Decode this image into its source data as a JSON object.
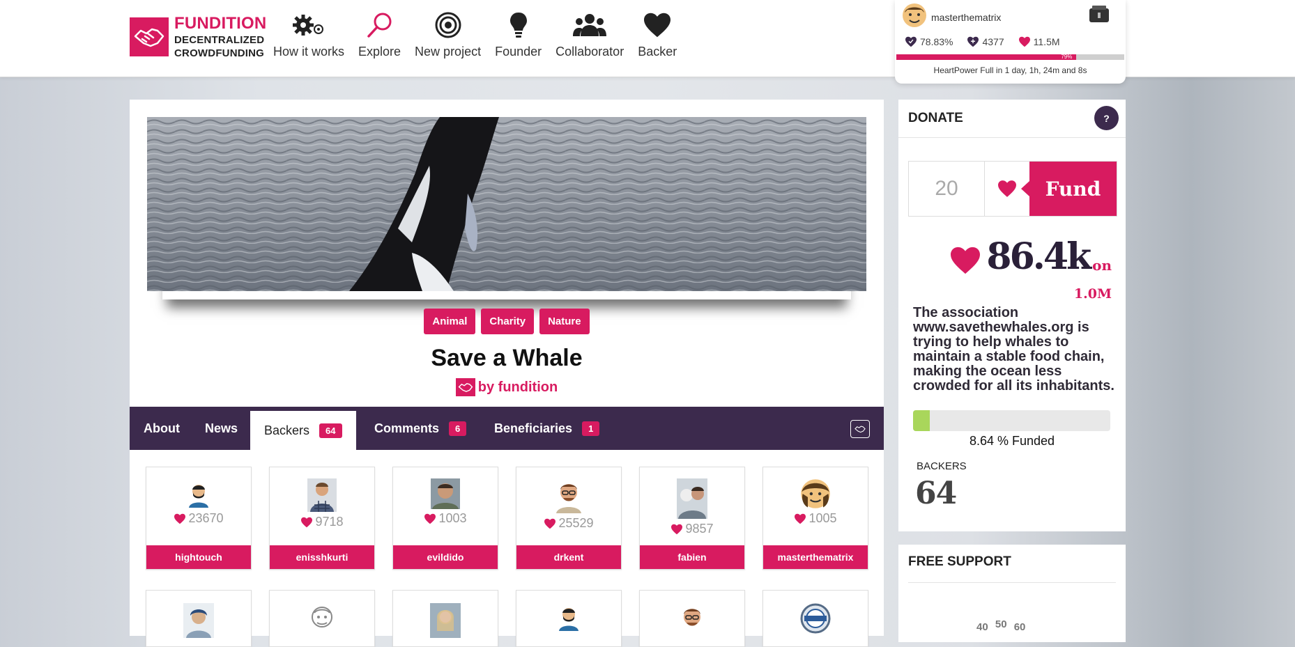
{
  "logo": {
    "line1": "FUNDITION",
    "line2": "DECENTRALIZED",
    "line3": "CROWDFUNDING"
  },
  "nav": [
    {
      "label": "How it works",
      "icon": "gears-icon"
    },
    {
      "label": "Explore",
      "icon": "search-icon"
    },
    {
      "label": "New project",
      "icon": "target-icon"
    },
    {
      "label": "Founder",
      "icon": "lightbulb-icon"
    },
    {
      "label": "Collaborator",
      "icon": "group-icon"
    },
    {
      "label": "Backer",
      "icon": "heart-icon"
    }
  ],
  "user": {
    "name": "masterthematrix",
    "stats": [
      {
        "value": "78.83%",
        "icon": "heart-outline-icon"
      },
      {
        "value": "4377",
        "icon": "heart-outline-icon"
      },
      {
        "value": "11.5M",
        "icon": "heart-icon"
      }
    ],
    "heartpower_percent": 79,
    "heartpower_label": "79%",
    "note": "HeartPower Full in 1 day, 1h, 24m and 8s"
  },
  "project": {
    "tags": [
      "Animal",
      "Charity",
      "Nature"
    ],
    "title": "Save a Whale",
    "byline": "by fundition"
  },
  "tabs": [
    {
      "label": "About",
      "count": null
    },
    {
      "label": "News",
      "count": null
    },
    {
      "label": "Backers",
      "count": "64"
    },
    {
      "label": "Comments",
      "count": "6"
    },
    {
      "label": "Beneficiaries",
      "count": "1"
    }
  ],
  "backers": [
    {
      "name": "hightouch",
      "hp": "23670"
    },
    {
      "name": "enisshkurti",
      "hp": "9718"
    },
    {
      "name": "evildido",
      "hp": "1003"
    },
    {
      "name": "drkent",
      "hp": "25529"
    },
    {
      "name": "fabien",
      "hp": "9857"
    },
    {
      "name": "masterthematrix",
      "hp": "1005"
    }
  ],
  "donate": {
    "heading": "DONATE",
    "help": "?",
    "amount_value": "20",
    "fund_label": "Fund",
    "raised": "86.4k",
    "on_label": "on",
    "goal": "1.0M",
    "description": "The association www.savethewhales.org is trying to help whales to maintain a stable food chain, making the ocean less crowded for all its inhabitants.",
    "funded_percent": 8.64,
    "funded_label": "8.64 % Funded",
    "backers_label": "BACKERS",
    "backers_count": "64"
  },
  "free_support": {
    "heading": "FREE SUPPORT",
    "gauge_ticks": [
      "40",
      "50",
      "60"
    ]
  },
  "colors": {
    "accent": "#d81b60",
    "dark": "#3c2a4d",
    "progress": "#a9d65b"
  }
}
